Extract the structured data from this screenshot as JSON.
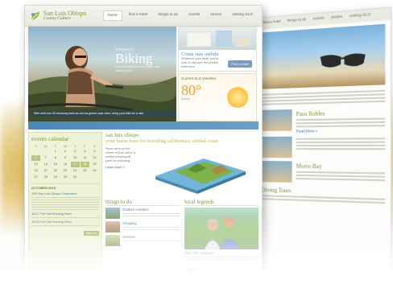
{
  "logo": {
    "line1": "San Luis Obispo",
    "line2": "County Culture"
  },
  "nav": [
    "home",
    "find a hotel",
    "things to do",
    "events",
    "stories",
    "visiting SLO"
  ],
  "hero": {
    "kicker": "Mountain",
    "title": "Biking",
    "blurb": "Miles of trails for enthusiasts and casual riders",
    "caption": "With well over 50 amazing trails as well as gentle road rides, bring your bike for a visit",
    "stay_title": "Come stay awhile",
    "stay_sub": "Whatever your taste, you're sure to discover the perfect hotel here",
    "find_hotel": "Find a Hotel",
    "weather_label": "Current SLO Weather",
    "weather_temp": "80°",
    "weather_sub": "Sunny"
  },
  "calendar": {
    "title": "events calendar",
    "days_head": [
      "S",
      "M",
      "T",
      "W",
      "T",
      "F",
      "S"
    ],
    "days": [
      "",
      "",
      "1",
      "2",
      "3",
      "4",
      "5",
      "6",
      "7",
      "8",
      "9",
      "10",
      "11",
      "12",
      "13",
      "14",
      "15",
      "16",
      "17",
      "18",
      "19",
      "20",
      "21",
      "22",
      "23",
      "24",
      "25",
      "26",
      "27",
      "28",
      "29",
      "30",
      "31",
      "",
      ""
    ],
    "month_label": "OCTOBER 2010",
    "events": [
      "10/6  San Luis Obispo Celebration",
      "10/17  Fall Trail Running Race",
      "10/18  Fall Trail Running Race"
    ],
    "more": "View All"
  },
  "intro": {
    "heading": "san luis obispo",
    "subheading": "your home base for traveling california's central coast",
    "text": "Since we're at the center of it all, we're a perfect jumping-off point for exploring",
    "link": "Learn More »"
  },
  "todo": {
    "title": "things to do",
    "items": [
      "Outdoor Activities",
      "Shopping",
      "Wineries"
    ]
  },
  "legends": {
    "title": "local legends",
    "caption": "Stay with a Legend",
    "more": "more"
  },
  "back": {
    "nav": [
      "find a hotel",
      "things to do",
      "events",
      "stories",
      "visiting SLO"
    ],
    "sections": [
      "Paso Robles",
      "Morro Bay",
      "Diving Tours"
    ],
    "link": "Read More »"
  }
}
